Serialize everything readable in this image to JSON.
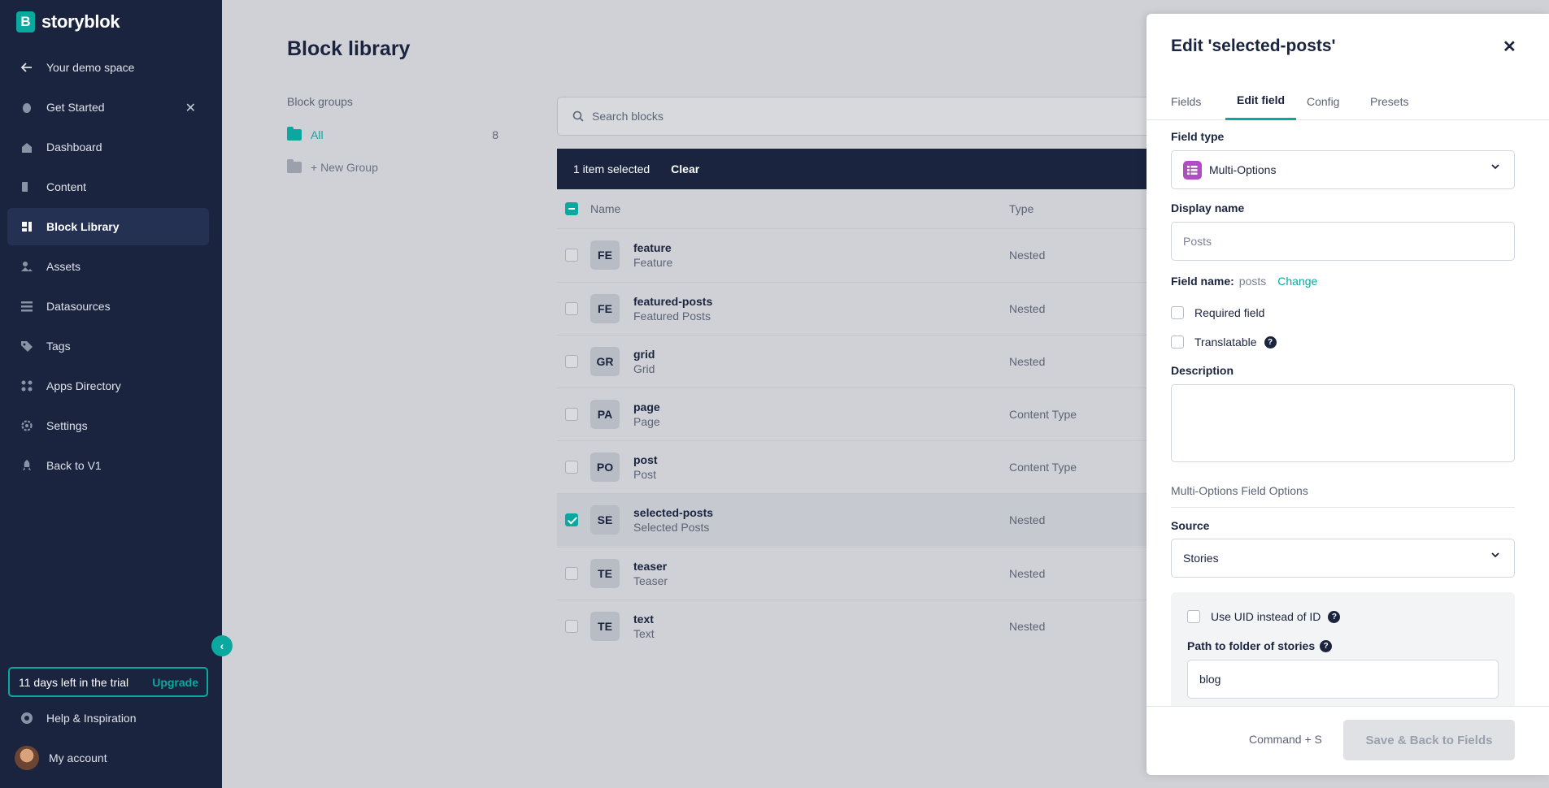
{
  "app": {
    "brand": "storyblok",
    "brand_initial": "B",
    "accent": "#0aa89e",
    "sidebar_bg": "#1b243f"
  },
  "sidebar": {
    "back_label": "Your demo space",
    "items": [
      {
        "label": "Get Started",
        "icon": "hand-wave-icon"
      },
      {
        "label": "Dashboard",
        "icon": "home-icon"
      },
      {
        "label": "Content",
        "icon": "content-icon"
      },
      {
        "label": "Block Library",
        "icon": "block-library-icon",
        "active": true
      },
      {
        "label": "Assets",
        "icon": "assets-icon"
      },
      {
        "label": "Datasources",
        "icon": "datasources-icon"
      },
      {
        "label": "Tags",
        "icon": "tag-icon"
      },
      {
        "label": "Apps Directory",
        "icon": "apps-icon"
      },
      {
        "label": "Settings",
        "icon": "gear-icon"
      },
      {
        "label": "Back to V1",
        "icon": "rocket-icon"
      }
    ],
    "trial_text": "11 days left in the trial",
    "upgrade_label": "Upgrade",
    "help_label": "Help & Inspiration",
    "account_label": "My account"
  },
  "main": {
    "title": "Block library",
    "groups_label": "Block groups",
    "groups": [
      {
        "label": "All",
        "count": "8"
      },
      {
        "label": "+ New Group",
        "count": ""
      }
    ],
    "search_placeholder": "Search blocks",
    "selection": {
      "text": "1 item selected",
      "clear_label": "Clear"
    },
    "columns": {
      "name": "Name",
      "type": "Type"
    },
    "rows": [
      {
        "badge": "FE",
        "name": "feature",
        "display": "Feature",
        "type": "Nested",
        "checked": false
      },
      {
        "badge": "FE",
        "name": "featured-posts",
        "display": "Featured Posts",
        "type": "Nested",
        "checked": false
      },
      {
        "badge": "GR",
        "name": "grid",
        "display": "Grid",
        "type": "Nested",
        "checked": false
      },
      {
        "badge": "PA",
        "name": "page",
        "display": "Page",
        "type": "Content Type",
        "checked": false
      },
      {
        "badge": "PO",
        "name": "post",
        "display": "Post",
        "type": "Content Type",
        "checked": false
      },
      {
        "badge": "SE",
        "name": "selected-posts",
        "display": "Selected Posts",
        "type": "Nested",
        "checked": true
      },
      {
        "badge": "TE",
        "name": "teaser",
        "display": "Teaser",
        "type": "Nested",
        "checked": false
      },
      {
        "badge": "TE",
        "name": "text",
        "display": "Text",
        "type": "Nested",
        "checked": false
      }
    ]
  },
  "panel": {
    "title": "Edit 'selected-posts'",
    "tabs": [
      "Fields",
      "Edit field",
      "Config",
      "Presets"
    ],
    "active_tab": "Edit field",
    "field_type_label": "Field type",
    "field_type_value": "Multi-Options",
    "display_name_label": "Display name",
    "display_name_placeholder": "Posts",
    "field_name_label": "Field name:",
    "field_name_value": "posts",
    "change_label": "Change",
    "required_label": "Required field",
    "translatable_label": "Translatable",
    "description_label": "Description",
    "options_section": "Multi-Options Field Options",
    "source_label": "Source",
    "source_value": "Stories",
    "use_uid_label": "Use UID instead of ID",
    "path_label": "Path to folder of stories",
    "path_value": "blog",
    "shortcut_hint": "Command + S",
    "save_label": "Save & Back to Fields"
  }
}
